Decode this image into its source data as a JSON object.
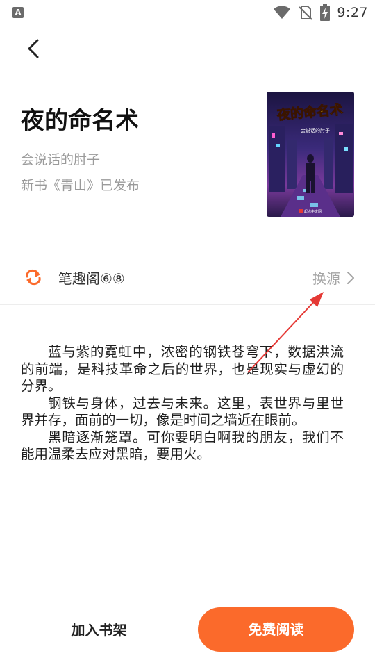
{
  "status_bar": {
    "app_icon_letter": "A",
    "time": "9:27",
    "icons": [
      "wifi-icon",
      "no-sim-icon",
      "battery-charging-icon"
    ]
  },
  "nav": {
    "back_icon": "chevron-left-icon"
  },
  "book": {
    "title": "夜的命名术",
    "author": "会说话的肘子",
    "notice": "新书《青山》已发布",
    "cover": {
      "title_art": "夜的命名术",
      "author_art": "会说话的肘子",
      "publisher_mark": "起点中文网"
    }
  },
  "source": {
    "icon": "refresh-icon",
    "name": "笔趣阁⑥⑧",
    "switch_label": "换源",
    "switch_icon": "chevron-right-icon"
  },
  "synopsis": {
    "paragraphs": [
      "蓝与紫的霓虹中，浓密的钢铁苍穹下，数据洪流的前端，是科技革命之后的世界，也是现实与虚幻的分界。",
      "钢铁与身体，过去与未来。这里，表世界与里世界并存，面前的一切，像是时间之墙近在眼前。",
      "黑暗逐渐笼罩。可你要明白啊我的朋友，我们不能用温柔去应对黑暗，要用火。"
    ]
  },
  "bottom_bar": {
    "add_shelf_label": "加入书架",
    "read_label": "免费阅读"
  },
  "colors": {
    "accent": "#fb6a2b",
    "secondary_text": "#9a9a9a",
    "annotation_arrow": "#e53935"
  }
}
